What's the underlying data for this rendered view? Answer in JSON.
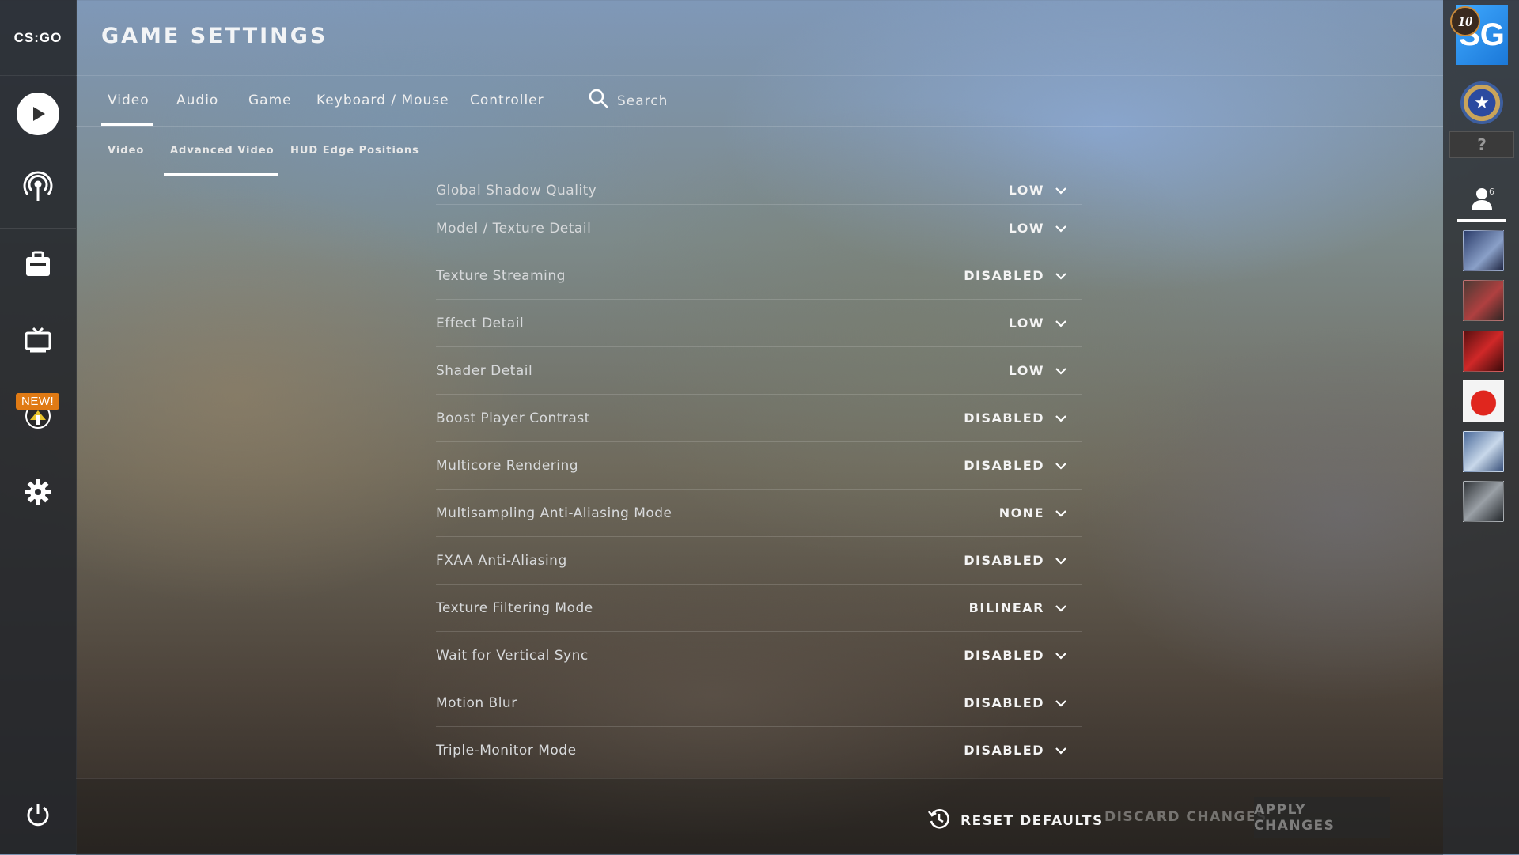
{
  "app": {
    "logo_text": "CS:GO"
  },
  "left_nav": {
    "items": [
      {
        "icon": "play-icon"
      },
      {
        "icon": "broadcast-icon"
      },
      {
        "icon": "inventory-icon"
      },
      {
        "icon": "tv-icon"
      },
      {
        "icon": "operation-icon",
        "badge": "NEW!"
      },
      {
        "icon": "gear-icon"
      }
    ],
    "power_icon": "power-icon"
  },
  "header": {
    "title": "GAME SETTINGS"
  },
  "tabs": [
    {
      "label": "Video",
      "active": true
    },
    {
      "label": "Audio"
    },
    {
      "label": "Game"
    },
    {
      "label": "Keyboard / Mouse"
    },
    {
      "label": "Controller"
    }
  ],
  "search": {
    "label": "Search"
  },
  "subtabs": [
    {
      "label": "Video"
    },
    {
      "label": "Advanced Video",
      "active": true
    },
    {
      "label": "HUD Edge Positions"
    }
  ],
  "settings": [
    {
      "label": "Global Shadow Quality",
      "value": "LOW"
    },
    {
      "label": "Model / Texture Detail",
      "value": "LOW"
    },
    {
      "label": "Texture Streaming",
      "value": "DISABLED"
    },
    {
      "label": "Effect Detail",
      "value": "LOW"
    },
    {
      "label": "Shader Detail",
      "value": "LOW"
    },
    {
      "label": "Boost Player Contrast",
      "value": "DISABLED"
    },
    {
      "label": "Multicore Rendering",
      "value": "DISABLED"
    },
    {
      "label": "Multisampling Anti-Aliasing Mode",
      "value": "NONE"
    },
    {
      "label": "FXAA Anti-Aliasing",
      "value": "DISABLED"
    },
    {
      "label": "Texture Filtering Mode",
      "value": "BILINEAR"
    },
    {
      "label": "Wait for Vertical Sync",
      "value": "DISABLED"
    },
    {
      "label": "Motion Blur",
      "value": "DISABLED"
    },
    {
      "label": "Triple-Monitor Mode",
      "value": "DISABLED"
    }
  ],
  "footer": {
    "reset_label": "RESET DEFAULTS",
    "discard_label": "DISCARD CHANGES",
    "apply_label": "APPLY CHANGES"
  },
  "profile": {
    "avatar_text": "SG",
    "level": "10",
    "rank_unknown": "?",
    "friends_online": "6"
  },
  "colors": {
    "accent": "#ffffff",
    "badge": "#e07a14",
    "avatar_blue": "#1b78d8"
  }
}
